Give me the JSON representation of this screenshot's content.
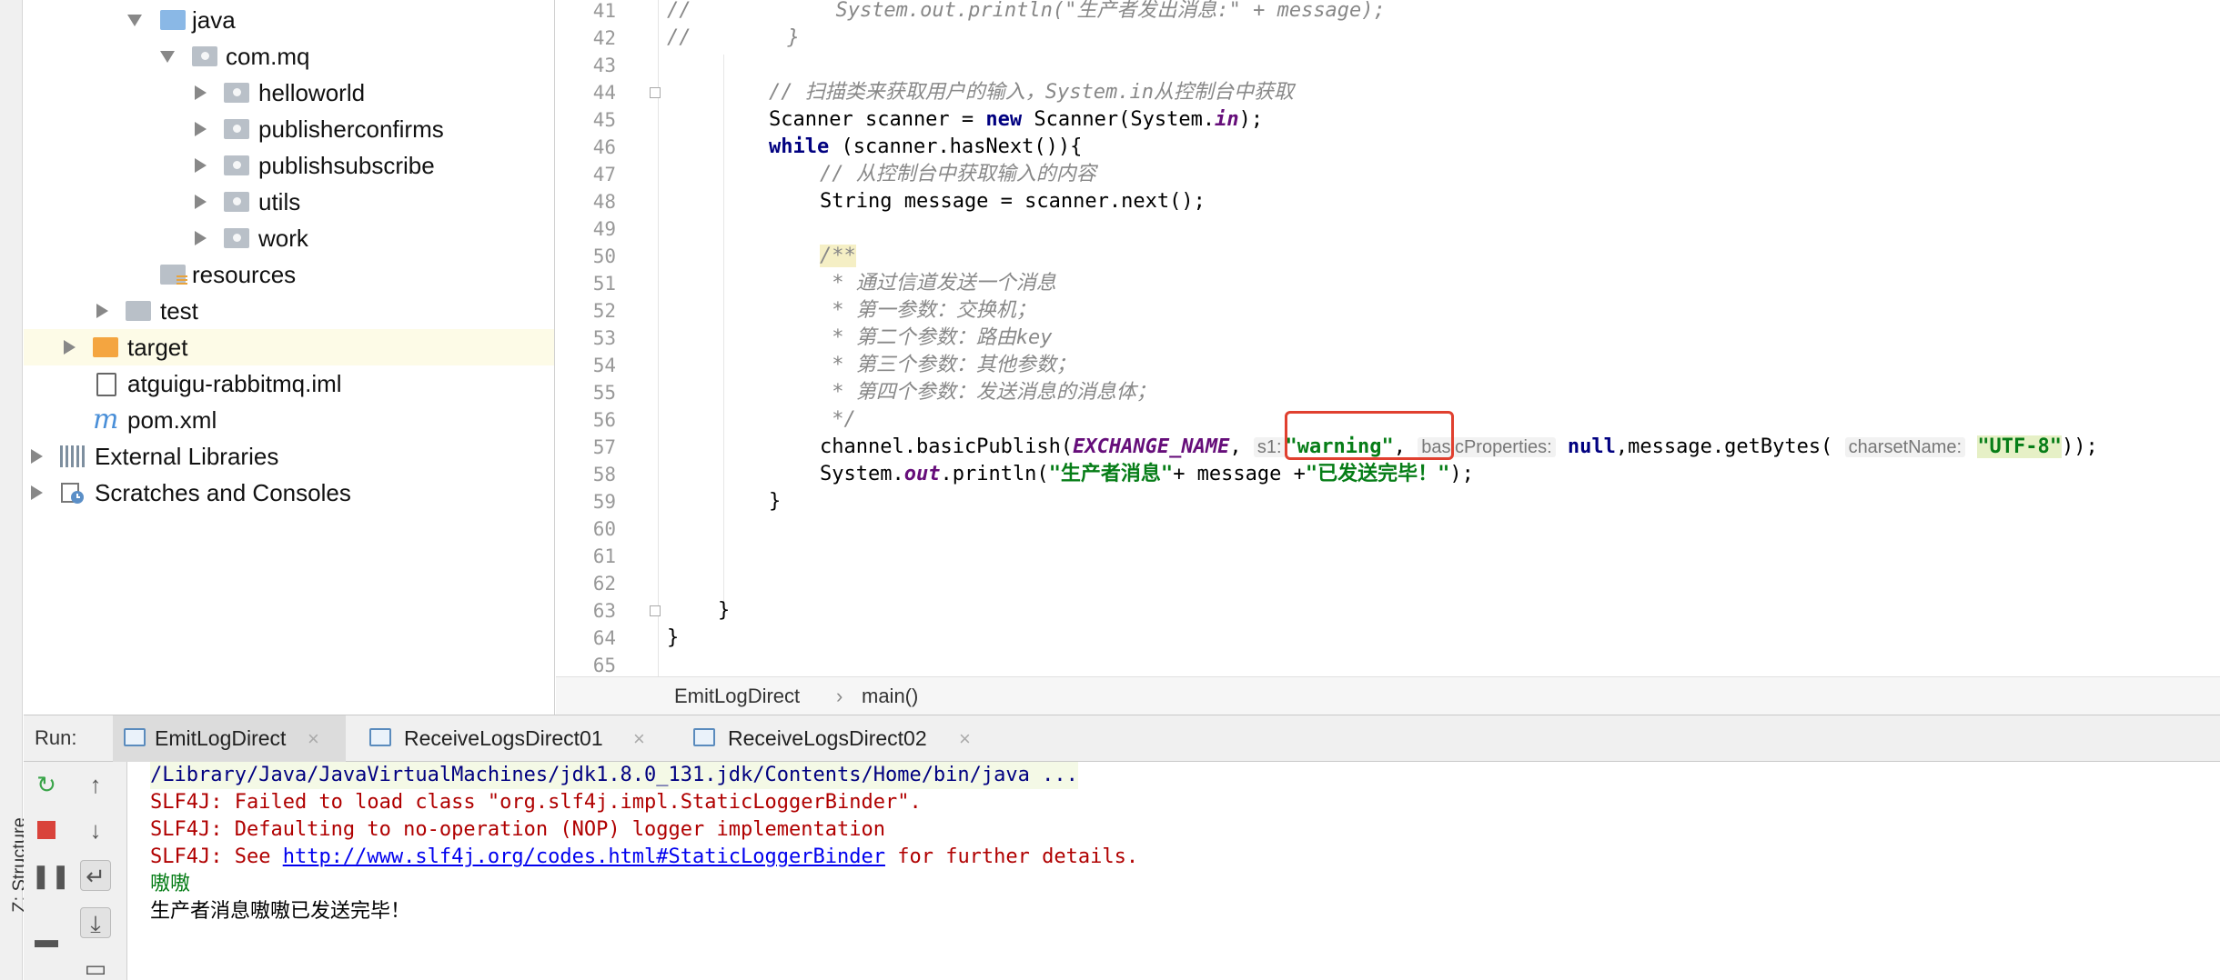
{
  "side_strip": {
    "label": "Z: Structure"
  },
  "tree": {
    "items": [
      {
        "label": "java",
        "icon": "folder-icon"
      },
      {
        "label": "com.mq",
        "icon": "package-icon"
      },
      {
        "label": "helloworld",
        "icon": "package-icon"
      },
      {
        "label": "publisherconfirms",
        "icon": "package-icon"
      },
      {
        "label": "publishsubscribe",
        "icon": "package-icon"
      },
      {
        "label": "utils",
        "icon": "package-icon"
      },
      {
        "label": "work",
        "icon": "package-icon"
      },
      {
        "label": "resources",
        "icon": "resources-folder-icon"
      },
      {
        "label": "test",
        "icon": "folder-icon"
      },
      {
        "label": "target",
        "icon": "excluded-folder-icon"
      },
      {
        "label": "atguigu-rabbitmq.iml",
        "icon": "iml-file-icon"
      },
      {
        "label": "pom.xml",
        "icon": "maven-icon"
      },
      {
        "label": "External Libraries",
        "icon": "library-icon"
      },
      {
        "label": "Scratches and Consoles",
        "icon": "scratches-icon"
      }
    ]
  },
  "editor": {
    "line_numbers": [
      "41",
      "42",
      "43",
      "44",
      "45",
      "46",
      "47",
      "48",
      "49",
      "50",
      "51",
      "52",
      "53",
      "54",
      "55",
      "56",
      "57",
      "58",
      "59",
      "60",
      "61",
      "62",
      "63",
      "64",
      "65"
    ],
    "lines": {
      "l41a": "//",
      "l41b": "System.out.println(\"生产者发出消息:\" + message);",
      "l42a": "//",
      "l42b": "}",
      "l44": "// 扫描类来获取用户的输入，System.in从控制台中获取",
      "l45a": "Scanner scanner = ",
      "l45kw": "new",
      "l45b": " Scanner(System.",
      "l45c": "in",
      "l45d": ");",
      "l46kw": "while",
      "l46b": " (scanner.hasNext()){",
      "l47": "// 从控制台中获取输入的内容",
      "l48": "String message = scanner.next();",
      "l50": "/**",
      "l51": " * 通过信道发送一个消息",
      "l52": " * 第一参数：交换机；",
      "l53a": " * 第二个参数：路由",
      "l53b": "key",
      "l54": " * 第三个参数：其他参数；",
      "l55": " * 第四个参数：发送消息的消息体；",
      "l56": " */",
      "l57a": "channel.basicPublish(",
      "l57const": "EXCHANGE_NAME",
      "l57b": ", ",
      "l57hint1": "s1:",
      "l57str1": "\"warning\"",
      "l57c": ", ",
      "l57hint2": "basicProperties:",
      "l57null": "null",
      "l57d": ",message.getBytes(",
      "l57hint3": "charsetName:",
      "l57str2": "\"UTF-8\"",
      "l57e": "));",
      "l58a": "System.",
      "l58out": "out",
      "l58b": ".println(",
      "l58str1": "\"生产者消息\"",
      "l58c": "+ message +",
      "l58str2": "\"已发送完毕！\"",
      "l58d": ");",
      "l59": "}",
      "l63": "}",
      "l64": "}"
    }
  },
  "breadcrumb": {
    "class": "EmitLogDirect",
    "sep": "›",
    "method": "main()"
  },
  "run": {
    "label": "Run:",
    "tabs": [
      {
        "label": "EmitLogDirect",
        "active": true
      },
      {
        "label": "ReceiveLogsDirect01",
        "active": false
      },
      {
        "label": "ReceiveLogsDirect02",
        "active": false
      }
    ],
    "close": "×"
  },
  "console": {
    "line1": "/Library/Java/JavaVirtualMachines/jdk1.8.0_131.jdk/Contents/Home/bin/java ...",
    "line2": "SLF4J: Failed to load class \"org.slf4j.impl.StaticLoggerBinder\".",
    "line3": "SLF4J: Defaulting to no-operation (NOP) logger implementation",
    "line4a": "SLF4J: See ",
    "line4link": "http://www.slf4j.org/codes.html#StaticLoggerBinder",
    "line4b": " for further details.",
    "line5": "嗷嗷",
    "line6": "生产者消息嗷嗷已发送完毕！"
  },
  "colors": {
    "keyword": "#000080",
    "string": "#067d17",
    "field": "#660e7a",
    "error": "#b00000",
    "highlight_box": "#e0402f"
  }
}
